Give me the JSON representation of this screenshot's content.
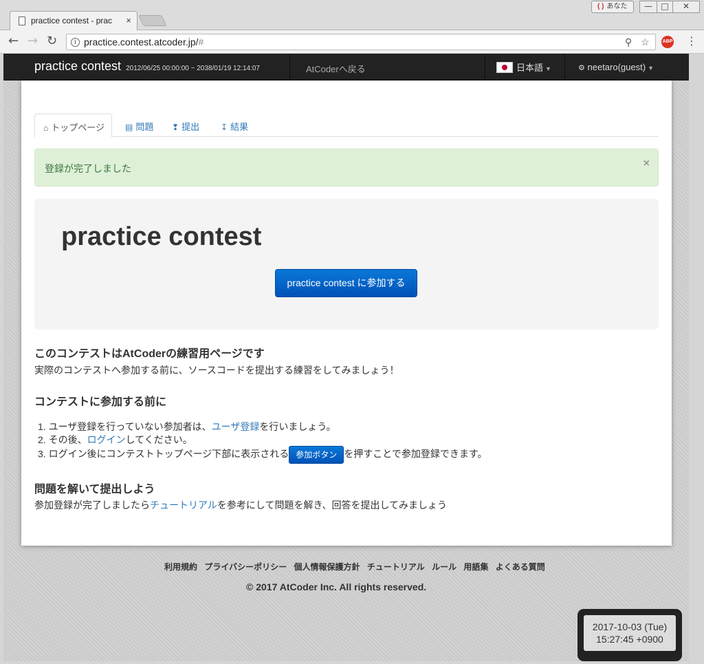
{
  "browser": {
    "tab_title": "practice contest - prac",
    "tab_close": "×",
    "user_badge": "あなた",
    "user_badge_icon": "( )",
    "url_host": "practice.contest.atcoder.jp/",
    "url_rest": "#",
    "abp_label": "ABP",
    "win_minimize": "—",
    "win_maximize": "□",
    "win_close": "✕"
  },
  "navbar": {
    "brand": "practice contest",
    "period": "2012/06/25 00:00:00 ~ 2038/01/19 12:14:07",
    "back_link": "AtCoderへ戻る",
    "language": "日本語",
    "user": "neetaro(guest)"
  },
  "tabs": [
    {
      "label": "トップページ",
      "icon": "home-icon"
    },
    {
      "label": "問題",
      "icon": "list-icon"
    },
    {
      "label": "提出",
      "icon": "submit-icon"
    },
    {
      "label": "結果",
      "icon": "results-icon"
    }
  ],
  "alert": {
    "message": "登録が完了しました",
    "close": "×"
  },
  "jumbotron": {
    "title": "practice contest",
    "join_button": "practice contest に参加する"
  },
  "sections": {
    "s1_title": "このコンテストはAtCoderの練習用ページです",
    "s1_text": "実際のコンテストへ参加する前に、ソースコードを提出する練習をしてみましょう！",
    "s2_title": "コンテストに参加する前に",
    "steps": {
      "n1": "1.",
      "step1_pre": "ユーザ登録を行っていない参加者は、",
      "step1_link": "ユーザ登録",
      "step1_post": "を行いましょう。",
      "n2": "2.",
      "step2_pre": "その後、",
      "step2_link": "ログイン",
      "step2_post": "してください。",
      "n3": "3.",
      "step3_pre": "ログイン後にコンテストトップページ下部に表示される",
      "step3_button": "参加ボタン",
      "step3_post": "を押すことで参加登録できます。"
    },
    "s3_title": "問題を解いて提出しよう",
    "s3_pre": "参加登録が完了しましたら",
    "s3_link": "チュートリアル",
    "s3_post": "を参考にして問題を解き、回答を提出してみましょう"
  },
  "footer": {
    "links": [
      "利用規約",
      "プライバシーポリシー",
      "個人情報保護方針",
      "チュートリアル",
      "ルール",
      "用語集",
      "よくある質問"
    ],
    "copyright": "© 2017 AtCoder Inc. All rights reserved."
  },
  "clock": {
    "date": "2017-10-03 (Tue)",
    "time": "15:27:45 +0900"
  },
  "colors": {
    "navbar": "#222222",
    "link": "#337ab7",
    "alert_bg": "#dff0d8",
    "button": "#0a6cd0"
  }
}
